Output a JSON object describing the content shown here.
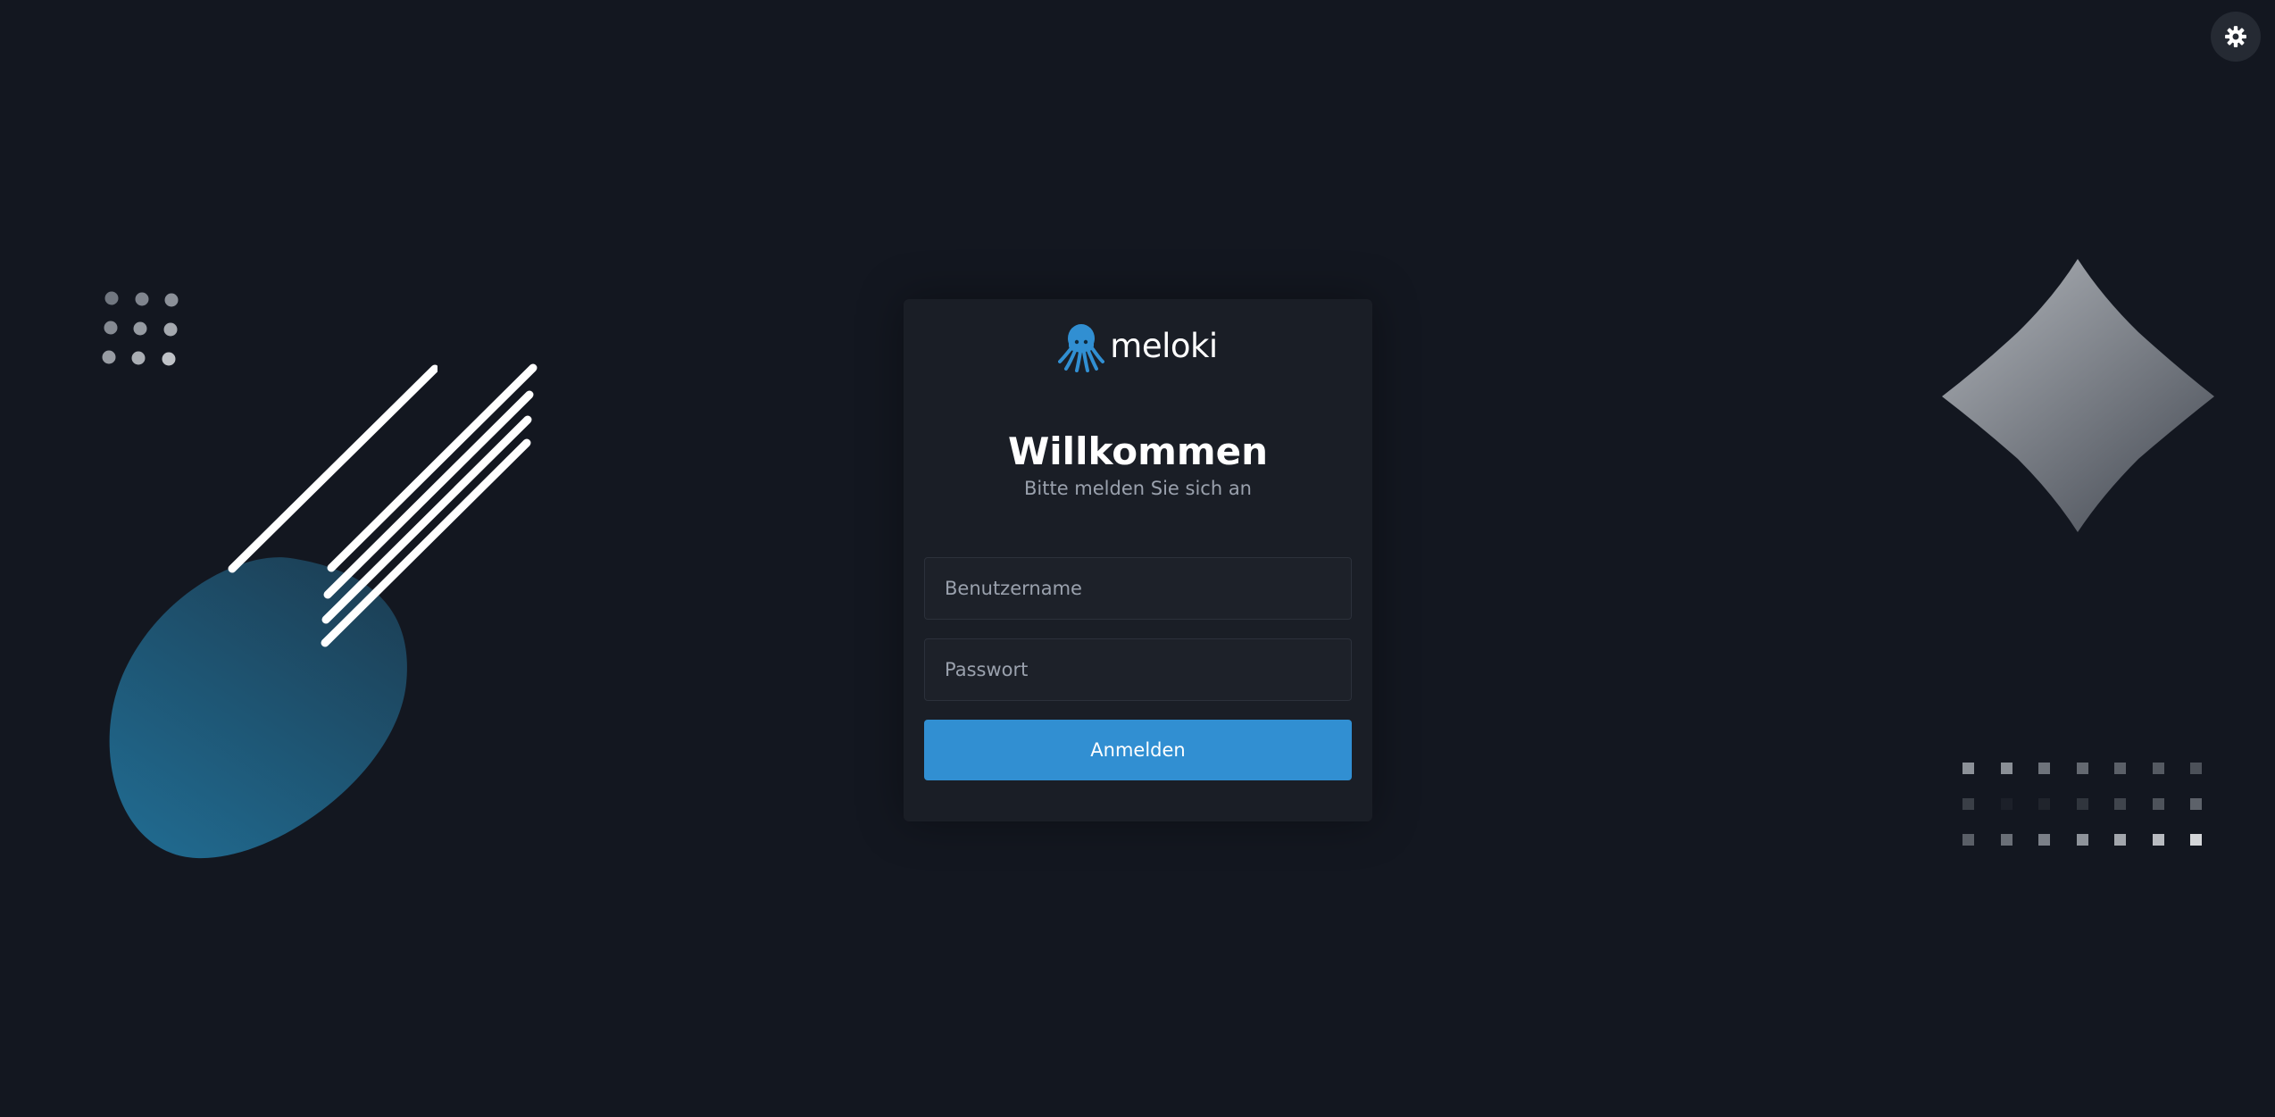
{
  "brand": {
    "name": "meloki",
    "logo_icon": "octopus-icon",
    "color": "#318fd2"
  },
  "login": {
    "title": "Willkommen",
    "subtitle": "Bitte melden Sie sich an",
    "username_placeholder": "Benutzername",
    "password_placeholder": "Passwort",
    "submit_label": "Anmelden"
  },
  "header": {
    "theme_toggle_icon": "gear-icon"
  },
  "colors": {
    "background": "#131720",
    "card": "#1a1e26",
    "accent": "#318fd2",
    "text": "#ffffff",
    "muted_text": "#9aa1ad"
  }
}
